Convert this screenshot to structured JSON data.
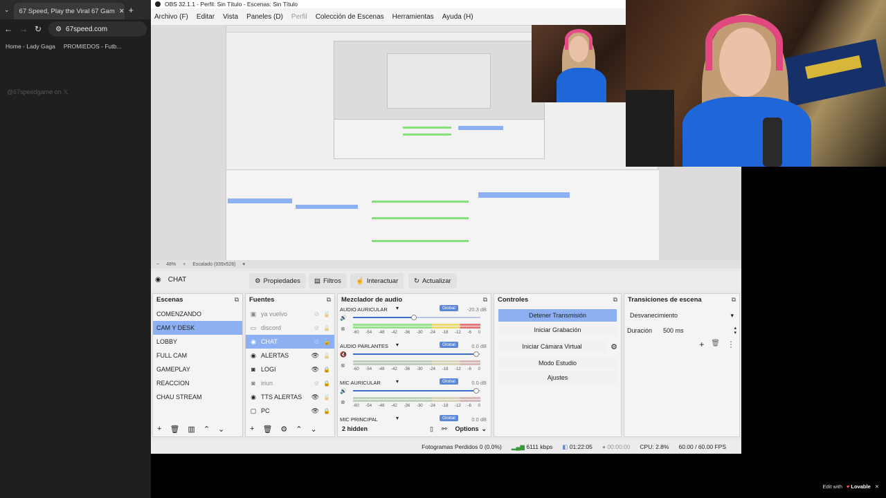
{
  "browser": {
    "tab_title": "67 Speed, Play the Viral 67 Gam",
    "tab_close": "✕",
    "new_tab": "+",
    "url": "67speed.com",
    "bookmarks": [
      "Home - Lady Gaga",
      "PROMIEDOS - Futb..."
    ],
    "tweet_text": "@67speedgame on"
  },
  "obs": {
    "title": "OBS 32.1.1 - Perfil: Sin Título - Escenas: Sin Título",
    "menu": [
      "Archivo (F)",
      "Editar",
      "Vista",
      "Paneles (D)",
      "Perfil",
      "Colección de Escenas",
      "Herramientas",
      "Ayuda (H)"
    ],
    "preview_zoom": "48%",
    "preview_scale": "Escalado (939x528)",
    "source_name": "CHAT",
    "source_buttons": {
      "properties": "Propiedades",
      "filters": "Filtros",
      "interact": "Interactuar",
      "refresh": "Actualizar"
    },
    "scenes": {
      "title": "Escenas",
      "items": [
        "COMENZANDO",
        "CAM Y DESK",
        "LOBBY",
        "FULL CAM",
        "GAMEPLAY",
        "REACCION",
        "CHAU STREAM"
      ],
      "selected": "CAM Y DESK"
    },
    "sources": {
      "title": "Fuentes",
      "items": [
        {
          "name": "ya vuelvo",
          "icon": "image-icon",
          "visible": false
        },
        {
          "name": "discord",
          "icon": "window-icon",
          "visible": false
        },
        {
          "name": "CHAT",
          "icon": "globe-icon",
          "visible": false
        },
        {
          "name": "ALERTAS",
          "icon": "globe-icon",
          "visible": true
        },
        {
          "name": "LOGI",
          "icon": "camera-icon",
          "visible": true
        },
        {
          "name": "iriun",
          "icon": "camera-icon",
          "visible": false
        },
        {
          "name": "TTS ALERTAS",
          "icon": "globe-icon",
          "visible": true
        },
        {
          "name": "PC",
          "icon": "monitor-icon",
          "visible": true
        }
      ]
    },
    "mixer": {
      "title": "Mezclador de audio",
      "global_label": "Global",
      "channels": [
        {
          "name": "AUDIO AURICULAR",
          "db": "-20.3 dB",
          "level": 0.45,
          "muted": false
        },
        {
          "name": "AUDIO PARLANTES",
          "db": "0.0 dB",
          "level": 0.0,
          "muted": true
        },
        {
          "name": "MIC AURICULAR",
          "db": "0.0 dB",
          "level": 0.0,
          "muted": false
        },
        {
          "name": "MIC PRINCIPAL",
          "db": "0.0 dB",
          "level": 0.0,
          "muted": false
        }
      ],
      "scale": [
        "-60",
        "-54",
        "-48",
        "-42",
        "-36",
        "-30",
        "-24",
        "-18",
        "-12",
        "-6",
        "0"
      ],
      "hidden": "2 hidden",
      "options": "Options"
    },
    "controls": {
      "title": "Controles",
      "stop_stream": "Detener Transmisión",
      "start_recording": "Iniciar Grabación",
      "start_virtual_cam": "Iniciar Cámara Virtual",
      "studio_mode": "Modo Estudio",
      "settings": "Ajustes"
    },
    "transitions": {
      "title": "Transiciones de escena",
      "selected": "Desvanecimiento",
      "duration_label": "Duración",
      "duration_value": "500 ms"
    },
    "status": {
      "dropped": "Fotogramas Perdidos 0 (0.0%)",
      "bitrate": "6111 kbps",
      "stream_time": "01:22:05",
      "record_time": "00:00:00",
      "cpu": "CPU: 2.8%",
      "fps": "60.00 / 60.00 FPS"
    }
  },
  "lovable": {
    "prefix": "Edit with",
    "brand": "Lovable"
  },
  "colors": {
    "accent": "#8cb0f2",
    "global": "#5b87d8",
    "shirt": "#1f67d8"
  }
}
